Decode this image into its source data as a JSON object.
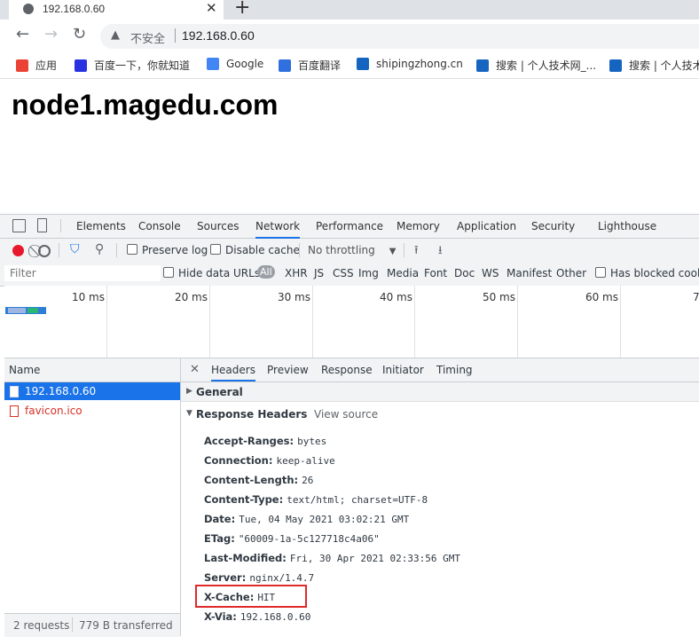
{
  "browser": {
    "tab_title": "192.168.0.60",
    "new_tab_glyph": "+",
    "close_glyph": "✕",
    "security_label": "不安全",
    "url": "192.168.0.60",
    "bookmarks": [
      {
        "label": "应用",
        "color": "#ea4335"
      },
      {
        "label": "百度一下，你就知道",
        "color": "#2932e1"
      },
      {
        "label": "Google",
        "color": "#4285f4"
      },
      {
        "label": "百度翻译",
        "color": "#2f6fde"
      },
      {
        "label": "shipingzhong.cn",
        "color": "#1565c0"
      },
      {
        "label": "搜索 | 个人技术网_...",
        "color": "#1565c0"
      },
      {
        "label": "搜索 | 个人技术",
        "color": "#1565c0"
      }
    ]
  },
  "page": {
    "heading": "node1.magedu.com"
  },
  "devtools": {
    "tabs": [
      "Elements",
      "Console",
      "Sources",
      "Network",
      "Performance",
      "Memory",
      "Application",
      "Security",
      "Lighthouse"
    ],
    "active_tab": "Network",
    "toolbar": {
      "preserve_log": "Preserve log",
      "disable_cache": "Disable cache",
      "throttling": "No throttling"
    },
    "filter": {
      "placeholder": "Filter",
      "hide_data_urls": "Hide data URLs",
      "types": [
        "All",
        "XHR",
        "JS",
        "CSS",
        "Img",
        "Media",
        "Font",
        "Doc",
        "WS",
        "Manifest",
        "Other"
      ],
      "has_blocked": "Has blocked cooki"
    },
    "timeline_ticks": [
      "10 ms",
      "20 ms",
      "30 ms",
      "40 ms",
      "50 ms",
      "60 ms",
      "7"
    ],
    "name_header": "Name",
    "requests": [
      {
        "name": "192.168.0.60",
        "selected": true
      },
      {
        "name": "favicon.ico",
        "error": true
      }
    ],
    "status_bar": {
      "requests": "2 requests",
      "transferred": "779 B transferred"
    },
    "detail_tabs": [
      "Headers",
      "Preview",
      "Response",
      "Initiator",
      "Timing"
    ],
    "detail_active": "Headers",
    "sections": {
      "general": "General",
      "response_headers": "Response Headers",
      "view_source": "View source"
    },
    "headers": [
      {
        "key": "Accept-Ranges:",
        "value": "bytes"
      },
      {
        "key": "Connection:",
        "value": "keep-alive"
      },
      {
        "key": "Content-Length:",
        "value": "26"
      },
      {
        "key": "Content-Type:",
        "value": "text/html; charset=UTF-8"
      },
      {
        "key": "Date:",
        "value": "Tue, 04 May 2021 03:02:21 GMT"
      },
      {
        "key": "ETag:",
        "value": "\"60009-1a-5c127718c4a06\""
      },
      {
        "key": "Last-Modified:",
        "value": "Fri, 30 Apr 2021 02:33:56 GMT"
      },
      {
        "key": "Server:",
        "value": "nginx/1.4.7"
      },
      {
        "key": "X-Cache:",
        "value": "HIT",
        "highlight": true
      },
      {
        "key": "X-Via:",
        "value": "192.168.0.60"
      }
    ]
  }
}
